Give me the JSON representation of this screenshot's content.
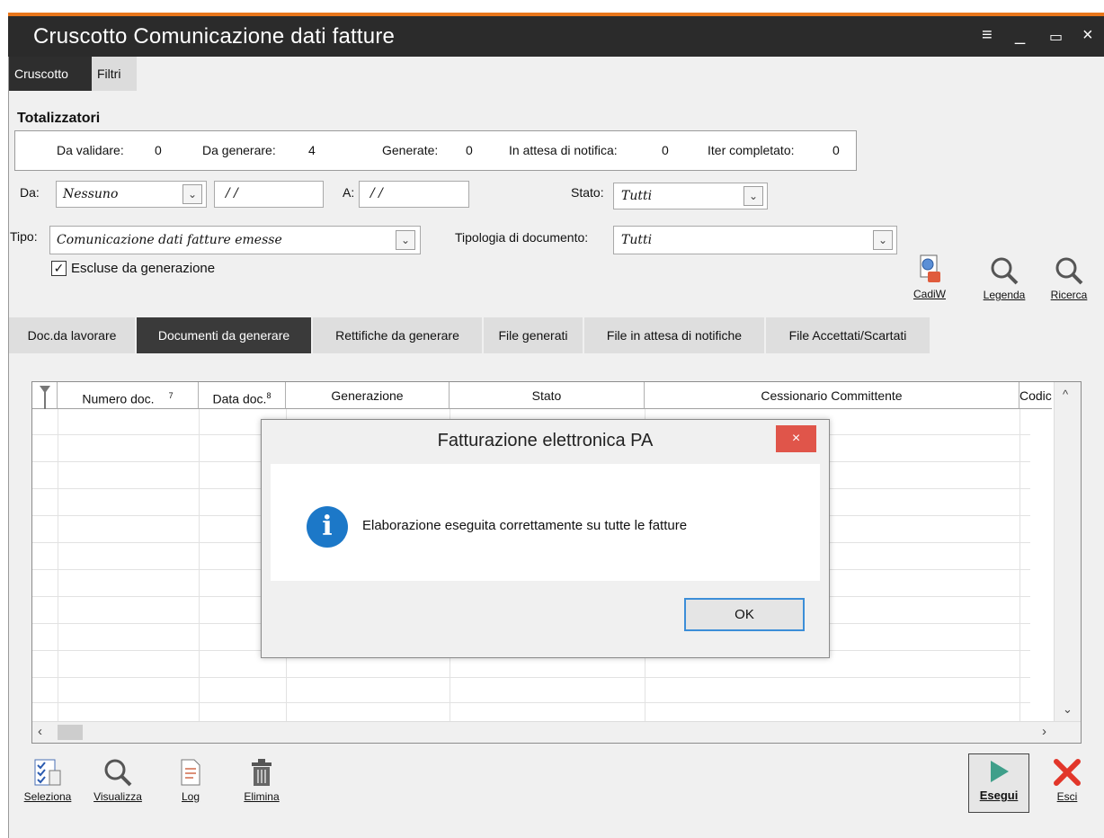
{
  "window": {
    "title": "Cruscotto Comunicazione dati fatture",
    "controls": [
      "≡",
      "_",
      "▭",
      "×"
    ]
  },
  "top_tabs": [
    "Cruscotto",
    "Filtri"
  ],
  "totalizzatori": {
    "heading": "Totalizzatori",
    "items": [
      {
        "label": "Da validare:",
        "value": "0"
      },
      {
        "label": "Da generare:",
        "value": "4"
      },
      {
        "label": "Generate:",
        "value": "0"
      },
      {
        "label": "In attesa di notifica:",
        "value": "0"
      },
      {
        "label": "Iter completato:",
        "value": "0"
      }
    ]
  },
  "filters": {
    "da_label": "Da:",
    "da_value": "Nessuno",
    "date_from": "/ /",
    "a_label": "A:",
    "date_to": "/ /",
    "stato_label": "Stato:",
    "stato_value": "Tutti",
    "tipo_label": "Tipo:",
    "tipo_value": "Comunicazione dati fatture emesse",
    "tipologia_label": "Tipologia di documento:",
    "tipologia_value": "Tutti",
    "escluse_label": "Escluse da generazione",
    "escluse_checked": true
  },
  "right_tools": [
    "CadiW",
    "Legenda",
    "Ricerca"
  ],
  "doc_tabs": [
    "Doc.da lavorare",
    "Documenti da generare",
    "Rettifiche da generare",
    "File generati",
    "File in attesa di notifiche",
    "File Accettati/Scartati"
  ],
  "grid": {
    "columns": [
      "Numero doc.",
      "Data doc.",
      "Generazione",
      "Stato",
      "Cessionario Committente",
      "Codic"
    ],
    "sort_marks": [
      "7",
      "8"
    ]
  },
  "dialog": {
    "title": "Fatturazione elettronica PA",
    "close": "×",
    "message": "Elaborazione eseguita correttamente su tutte le fatture",
    "ok": "OK"
  },
  "bottom_tools": [
    "Seleziona",
    "Visualizza",
    "Log",
    "Elimina"
  ],
  "actions": [
    "Esegui",
    "Esci"
  ],
  "colors": {
    "accent": "#e8761b",
    "titlebar": "#2b2b2b",
    "close_red": "#e0554a",
    "info_blue": "#1c78c8",
    "run_green": "#3f9f8a",
    "exit_red": "#e2362a"
  }
}
